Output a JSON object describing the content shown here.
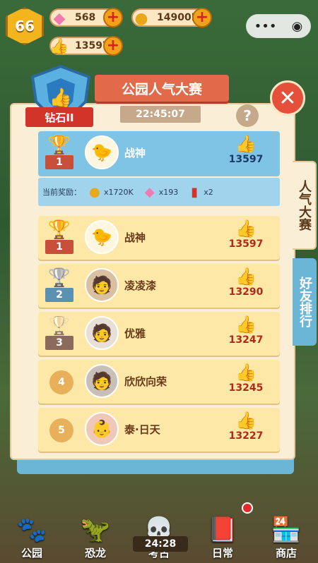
{
  "hud": {
    "level": "66",
    "gems": "568",
    "coins": "14900K",
    "likes": "13597",
    "menu_glyph": "•••",
    "record_glyph": "◉"
  },
  "event": {
    "title": "公园人气大赛",
    "rank_tier": "钻石II",
    "countdown": "22:45:07",
    "help_label": "?",
    "close_label": "✕"
  },
  "tabs": {
    "popularity": "人气大赛",
    "friends": "好友排行"
  },
  "my_entry": {
    "rank": "1",
    "name": "战神",
    "likes": "13597",
    "reward_label": "当前奖励：",
    "rewards": [
      {
        "icon": "coin-icon",
        "amount": "x1720K"
      },
      {
        "icon": "gem-icon",
        "amount": "x193"
      },
      {
        "icon": "card-icon",
        "amount": "x2"
      }
    ]
  },
  "ranking": [
    {
      "rank": "1",
      "name": "战神",
      "likes": "13597",
      "medal": "gold"
    },
    {
      "rank": "2",
      "name": "凌凌漆",
      "likes": "13290",
      "medal": "silver"
    },
    {
      "rank": "3",
      "name": "优雅",
      "likes": "13247",
      "medal": "bronze"
    },
    {
      "rank": "4",
      "name": "欣欣向荣",
      "likes": "13245",
      "medal": "none"
    },
    {
      "rank": "5",
      "name": "泰·日天",
      "likes": "13227",
      "medal": "none"
    }
  ],
  "nav": {
    "park": "公园",
    "dino": "恐龙",
    "archaeology": "考古",
    "daily": "日常",
    "shop": "商店",
    "timer": "24:28"
  },
  "colors": {
    "panel": "#fbeed6",
    "row": "#fde8a8",
    "my_row": "#7fc4e4",
    "accent_red": "#e5503a"
  }
}
